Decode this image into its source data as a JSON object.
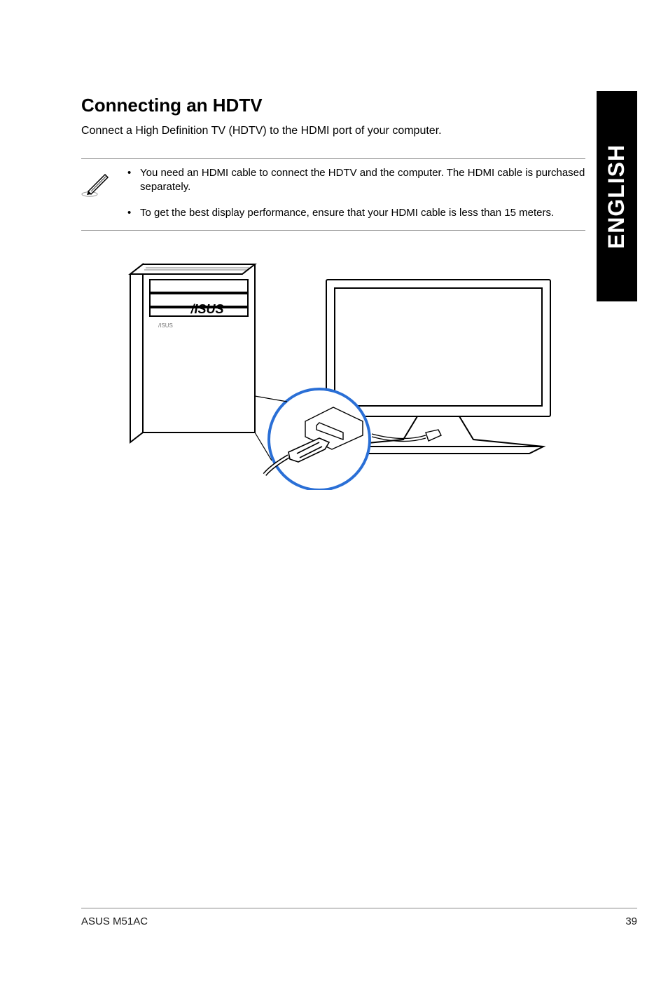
{
  "sidebar": {
    "language": "ENGLISH"
  },
  "page": {
    "heading": "Connecting an HDTV",
    "intro": "Connect a High Definition TV (HDTV) to the HDMI port of your computer.",
    "notes": [
      "You need an HDMI cable to connect the HDTV and the computer. The HDMI cable is purchased separately.",
      "To get the best display performance, ensure that your HDMI cable is less than 15 meters."
    ]
  },
  "footer": {
    "product": "ASUS M51AC",
    "page_number": "39"
  },
  "icons": {
    "note": "pencil-note-icon"
  }
}
